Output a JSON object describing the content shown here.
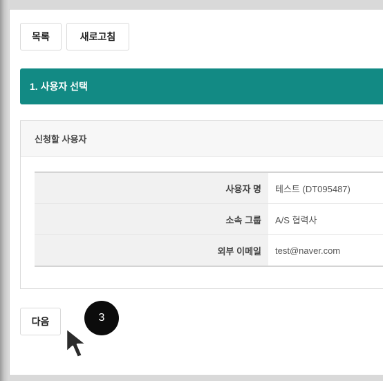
{
  "toolbar": {
    "list_label": "목록",
    "refresh_label": "새로고침"
  },
  "section": {
    "title": "1. 사용자 선택"
  },
  "panel": {
    "heading": "신청할 사용자",
    "rows": [
      {
        "label": "사용자 명",
        "value": "테스트 (DT095487)"
      },
      {
        "label": "소속 그룹",
        "value": "A/S 협력사"
      },
      {
        "label": "외부 이메일",
        "value": "test@naver.com"
      }
    ]
  },
  "footer": {
    "next_label": "다음"
  },
  "annotation": {
    "step_number": "3"
  },
  "icons": {
    "cursor": "mouse-pointer-icon"
  },
  "colors": {
    "section_header": "#128a84",
    "badge": "#0c0c0c"
  }
}
